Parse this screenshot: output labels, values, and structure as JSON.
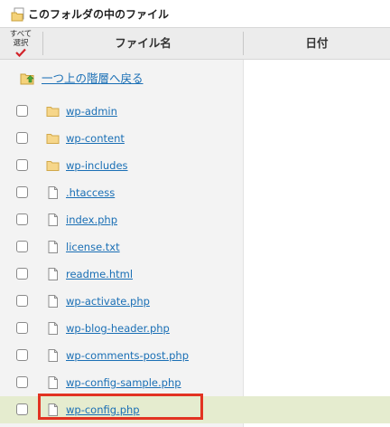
{
  "title": "このフォルダの中のファイル",
  "header": {
    "select_all": "すべて選択",
    "select_all_line1": "すべて",
    "select_all_line2": "選択",
    "file_name": "ファイル名",
    "date": "日付"
  },
  "up_link": "一つ上の階層へ戻る",
  "files": [
    {
      "name": "wp-admin",
      "type": "folder",
      "icon": "folder-icon"
    },
    {
      "name": "wp-content",
      "type": "folder",
      "icon": "folder-icon"
    },
    {
      "name": "wp-includes",
      "type": "folder",
      "icon": "folder-icon"
    },
    {
      "name": ".htaccess",
      "type": "file",
      "icon": "file-icon"
    },
    {
      "name": "index.php",
      "type": "file",
      "icon": "file-icon"
    },
    {
      "name": "license.txt",
      "type": "file",
      "icon": "file-icon"
    },
    {
      "name": "readme.html",
      "type": "file",
      "icon": "file-icon"
    },
    {
      "name": "wp-activate.php",
      "type": "file",
      "icon": "file-icon"
    },
    {
      "name": "wp-blog-header.php",
      "type": "file",
      "icon": "file-icon"
    },
    {
      "name": "wp-comments-post.php",
      "type": "file",
      "icon": "file-icon"
    },
    {
      "name": "wp-config-sample.php",
      "type": "file",
      "icon": "file-icon"
    },
    {
      "name": "wp-config.php",
      "type": "file",
      "icon": "file-icon",
      "selected": true
    }
  ],
  "colors": {
    "link": "#1a6fb5",
    "selected_row": "#e5eccf",
    "highlight_border": "#e23322",
    "header_bg": "#ececec"
  }
}
